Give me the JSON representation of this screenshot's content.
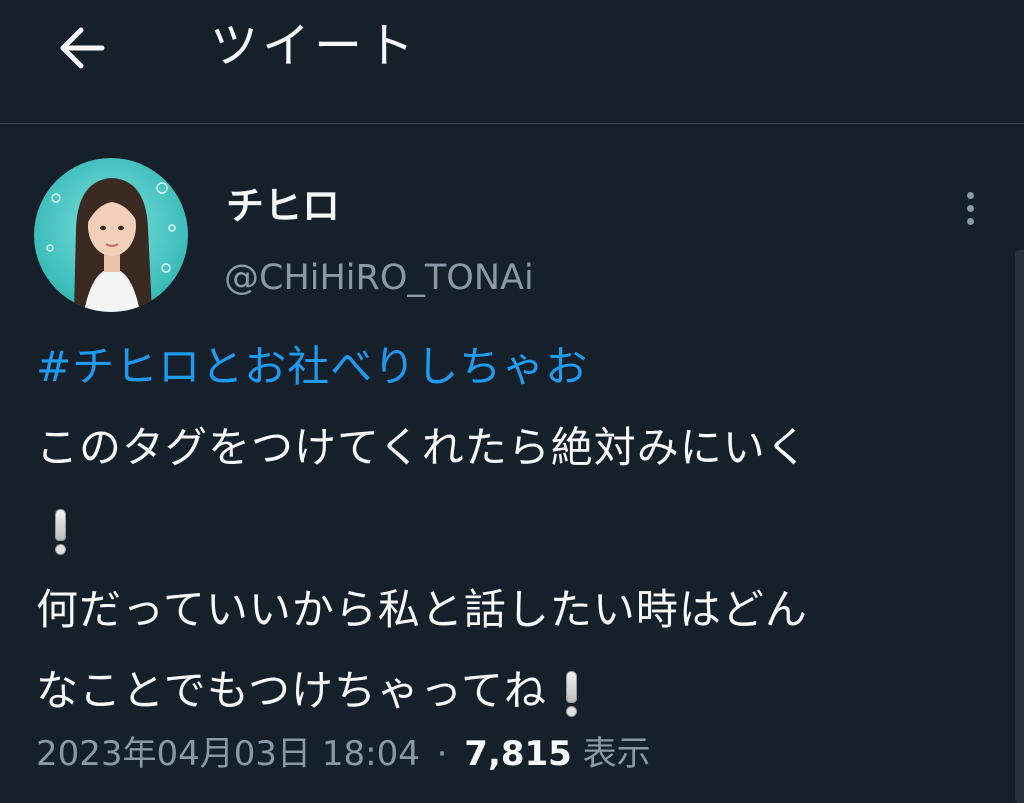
{
  "header": {
    "title": "ツイート",
    "back_icon": "arrow-left-icon"
  },
  "author": {
    "display_name": "チヒロ",
    "handle": "@CHiHiRO_TONAi",
    "more_icon": "more-vertical-icon"
  },
  "tweet": {
    "hashtag": "#チヒロとお社べりしちゃお",
    "line1": "このタグをつけてくれたら絶対みにいく",
    "line3": "何だっていいから私と話したい時はどん",
    "line4": "なことでもつけちゃってね",
    "emoji_icon": "white-exclamation-mark-icon"
  },
  "meta": {
    "timestamp": "2023年04月03日 18:04",
    "separator": "·",
    "views_count": "7,815",
    "views_label": "表示"
  },
  "colors": {
    "background": "#15202b",
    "text": "#f7f9f9",
    "secondary_text": "#8b98a5",
    "link": "#1d9bf0",
    "divider": "#38444d"
  }
}
